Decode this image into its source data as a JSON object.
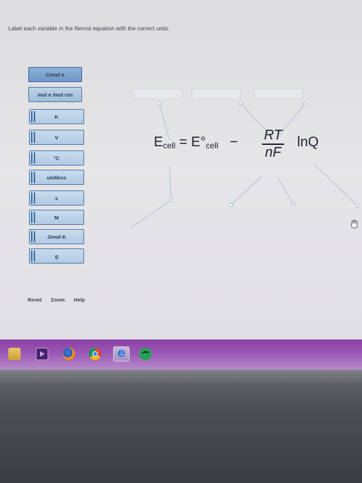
{
  "instruction": "Label each variable in the Nernst equation with the correct units.",
  "units": [
    {
      "label": "C/mol e",
      "state": "selected"
    },
    {
      "label": "mol e /mol rxn",
      "state": "default"
    },
    {
      "label": "K",
      "state": "placed"
    },
    {
      "label": "V",
      "state": "placed"
    },
    {
      "label": "°C",
      "state": "placed"
    },
    {
      "label": "unitless",
      "state": "placed"
    },
    {
      "label": "s",
      "state": "placed"
    },
    {
      "label": "M",
      "state": "placed"
    },
    {
      "label": "J/mol·K",
      "state": "placed"
    },
    {
      "label": "g",
      "state": "placed"
    }
  ],
  "equation": {
    "E": "E",
    "cell_sub": "cell",
    "equals": "=",
    "E0": "E°",
    "cell_sub2": "cell",
    "minus": "−",
    "numerator": "RT",
    "denominator": "nF",
    "ln": "lnQ"
  },
  "controls": {
    "reset": "Reset",
    "zoom": "Zoom",
    "help": "Help"
  },
  "icons": [
    "folder-icon",
    "media-player-icon",
    "firefox-icon",
    "chrome-icon",
    "internet-explorer-icon",
    "spotify-icon"
  ],
  "colors": {
    "unit_button": "#9fbdda",
    "unit_border": "#4f78a5",
    "taskbar": "#9a58b5"
  }
}
